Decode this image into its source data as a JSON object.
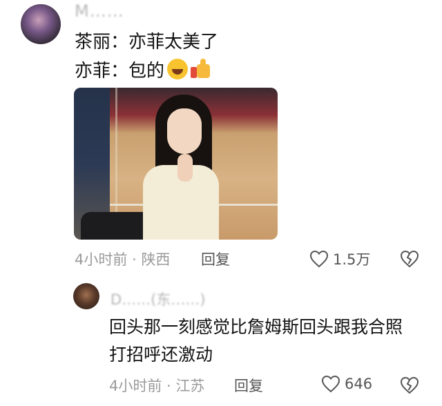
{
  "comment": {
    "username": "M……",
    "lines": [
      "茶丽：亦菲太美了",
      "亦菲：包的"
    ],
    "emojis": [
      "rolling-laughing-emoji",
      "thumbs-up-emoji"
    ],
    "meta": {
      "time": "4小时前",
      "sep": "·",
      "location": "陕西"
    },
    "reply_label": "回复",
    "likes": "1.5万"
  },
  "reply": {
    "username": "D……(东……)",
    "lines": [
      "回头那一刻感觉比詹姆斯回头跟我合照",
      "打招呼还激动"
    ],
    "meta": {
      "time": "4小时前",
      "sep": "·",
      "location": "江苏"
    },
    "reply_label": "回复",
    "likes": "646"
  },
  "colors": {
    "text": "#1a1a1a",
    "meta": "#9a9a9a",
    "icon": "#555555"
  }
}
